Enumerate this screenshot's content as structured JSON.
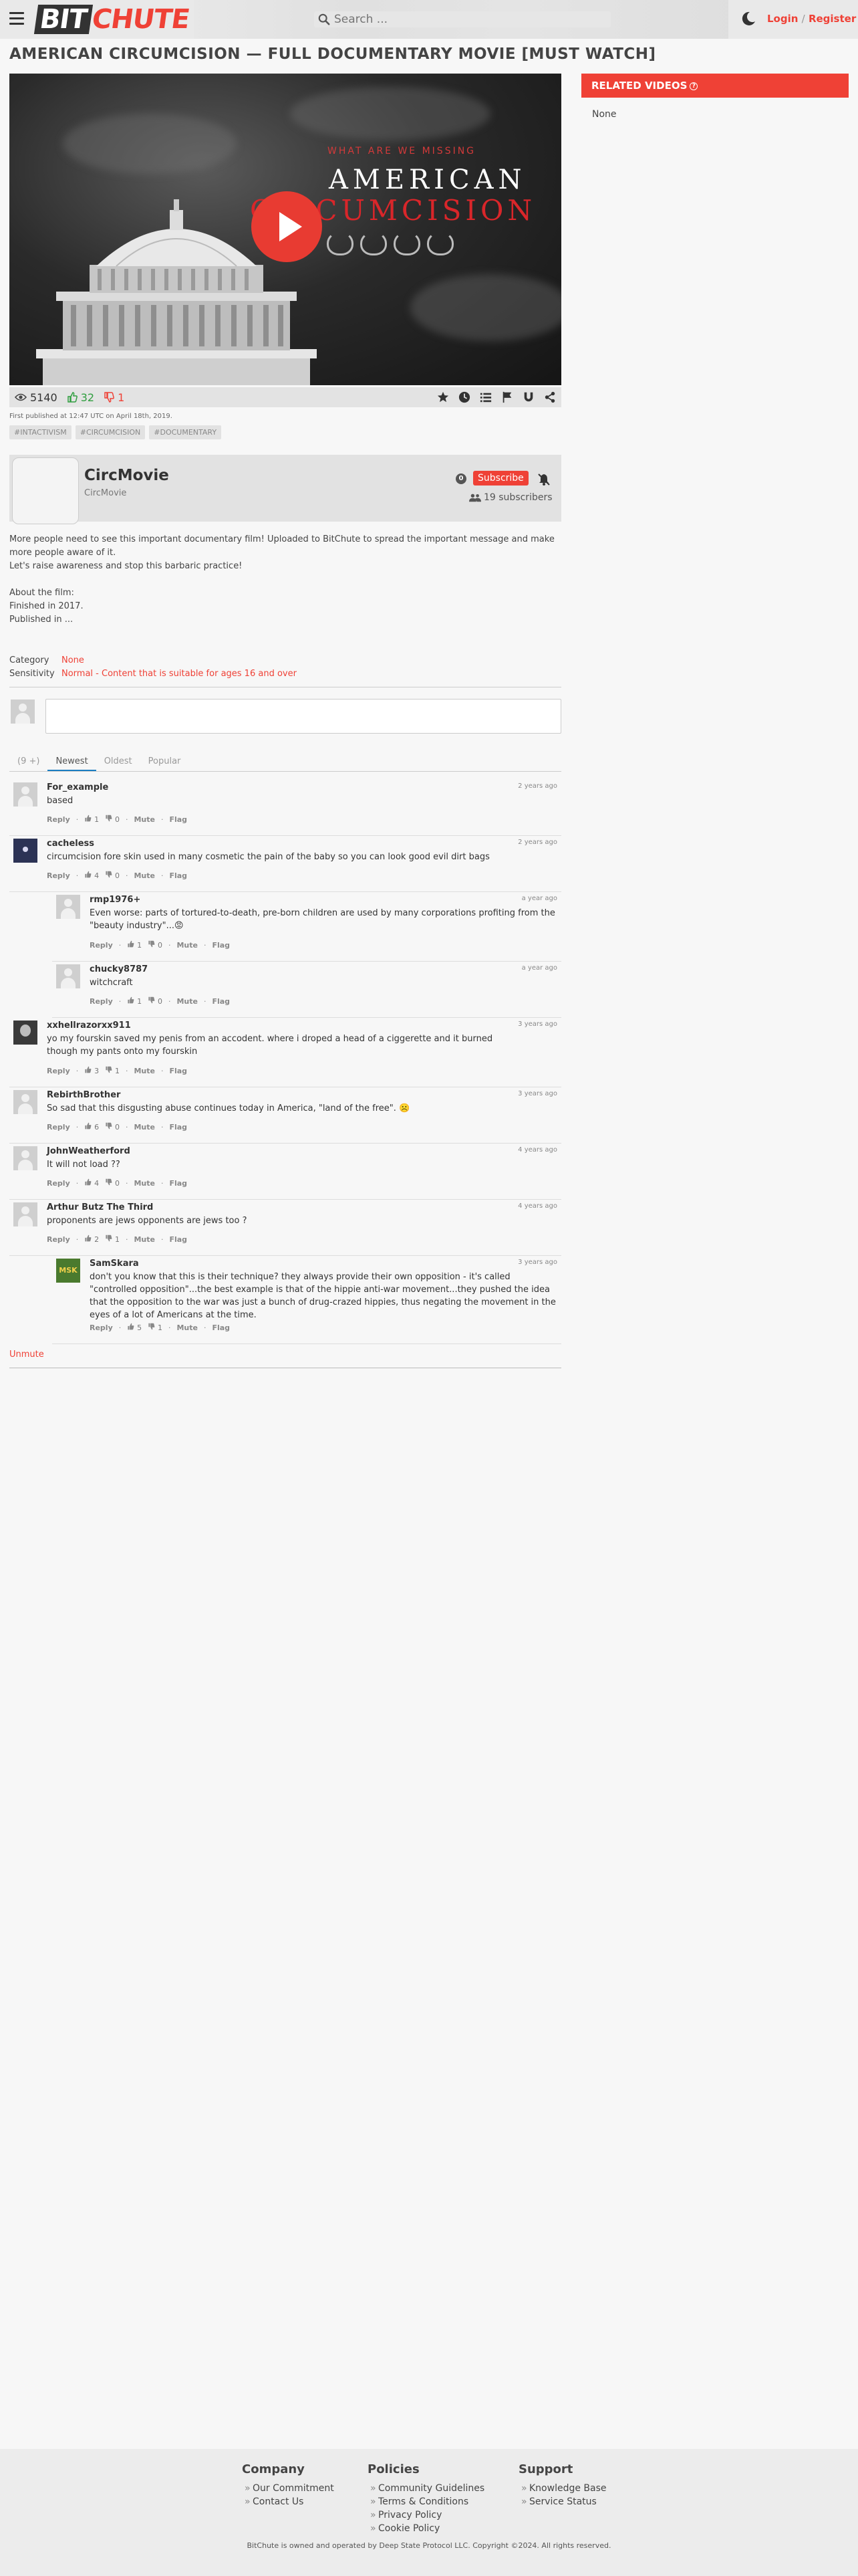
{
  "header": {
    "logo_bit": "BIT",
    "logo_chute": "CHUTE",
    "search_placeholder": "Search ...",
    "login": "Login",
    "separator": "/",
    "register": "Register"
  },
  "video": {
    "title": "AMERICAN CIRCUMCISION — FULL DOCUMENTARY MOVIE [MUST WATCH]",
    "poster_tagline": "WHAT ARE WE MISSING",
    "poster_title_1": "AMERICAN",
    "poster_title_2": "CIRCUMCISION",
    "views": "5140",
    "likes": "32",
    "dislikes": "1",
    "published": "First published at 12:47 UTC on April 18th, 2019.",
    "tags": [
      "#INTACTIVISM",
      "#CIRCUMCISION",
      "#DOCUMENTARY"
    ]
  },
  "channel": {
    "name": "CircMovie",
    "owner": "CircMovie",
    "notif_count": "0",
    "subscribe_label": "Subscribe",
    "subscribers": "19 subscribers"
  },
  "description": {
    "line1": "More people need to see this important documentary film! Uploaded to BitChute to spread the important message and make more people aware of it.",
    "line2": "Let's raise awareness and stop this barbaric practice!",
    "line3": "About the film:",
    "line4": "Finished in 2017.",
    "line5": "Published in ..."
  },
  "meta": {
    "category_label": "Category",
    "category_value": "None",
    "sensitivity_label": "Sensitivity",
    "sensitivity_value": "Normal - Content that is suitable for ages 16 and over"
  },
  "comments_ui": {
    "count_badge": "(9 +)",
    "tabs": [
      "Newest",
      "Oldest",
      "Popular"
    ],
    "reply": "Reply",
    "mute": "Mute",
    "flag": "Flag",
    "unmute": "Unmute"
  },
  "comments": [
    {
      "user": "For_example",
      "time": "2 years ago",
      "text": "based",
      "up": "1",
      "down": "0"
    },
    {
      "user": "cacheless",
      "time": "2 years ago",
      "text": "circumcision fore skin used in many cosmetic the pain of the baby so you can look good evil dirt bags",
      "up": "4",
      "down": "0"
    },
    {
      "user": "rmp1976+",
      "time": "a year ago",
      "text": "Even worse: parts of tortured-to-death, pre-born children are used by many corporations profiting from the \"beauty industry\"...😡",
      "up": "1",
      "down": "0"
    },
    {
      "user": "chucky8787",
      "time": "a year ago",
      "text": "witchcraft",
      "up": "1",
      "down": "0"
    },
    {
      "user": "xxhellrazorxx911",
      "time": "3 years ago",
      "text": "yo my fourskin saved my penis from an accodent. where i droped a head of a ciggerette and it burned though my pants onto my fourskin",
      "up": "3",
      "down": "1"
    },
    {
      "user": "RebirthBrother",
      "time": "3 years ago",
      "text": "So sad that this disgusting abuse continues today in America, \"land of the free\". ☹️",
      "up": "6",
      "down": "0"
    },
    {
      "user": "JohnWeatherford",
      "time": "4 years ago",
      "text": "It will not load ??",
      "up": "4",
      "down": "0"
    },
    {
      "user": "Arthur Butz The Third",
      "time": "4 years ago",
      "text": "proponents are jews opponents are jews too ?",
      "up": "2",
      "down": "1"
    },
    {
      "user": "SamSkara",
      "time": "3 years ago",
      "text": "don't you know that this is their technique? they always provide their own opposition - it's called \"controlled opposition\"...the best example is that of the hippie anti-war movement...they pushed the idea that the opposition to the war was just a bunch of drug-crazed hippies, thus negating the movement in the eyes of a lot of Americans at the time.",
      "up": "5",
      "down": "1",
      "avatar_text": "MSK"
    }
  ],
  "related": {
    "heading": "RELATED VIDEOS",
    "help": "?",
    "none": "None"
  },
  "footer": {
    "company": {
      "title": "Company",
      "items": [
        "Our Commitment",
        "Contact Us"
      ]
    },
    "policies": {
      "title": "Policies",
      "items": [
        "Community Guidelines",
        "Terms & Conditions",
        "Privacy Policy",
        "Cookie Policy"
      ]
    },
    "support": {
      "title": "Support",
      "items": [
        "Knowledge Base",
        "Service Status"
      ]
    },
    "copyright": "BitChute is owned and operated by Deep State Protocol LLC. Copyright ©2024. All rights reserved."
  },
  "colors": {
    "brand": "#ef4136",
    "like": "#2f9e3f",
    "tab_active": "#1b7ec2"
  }
}
